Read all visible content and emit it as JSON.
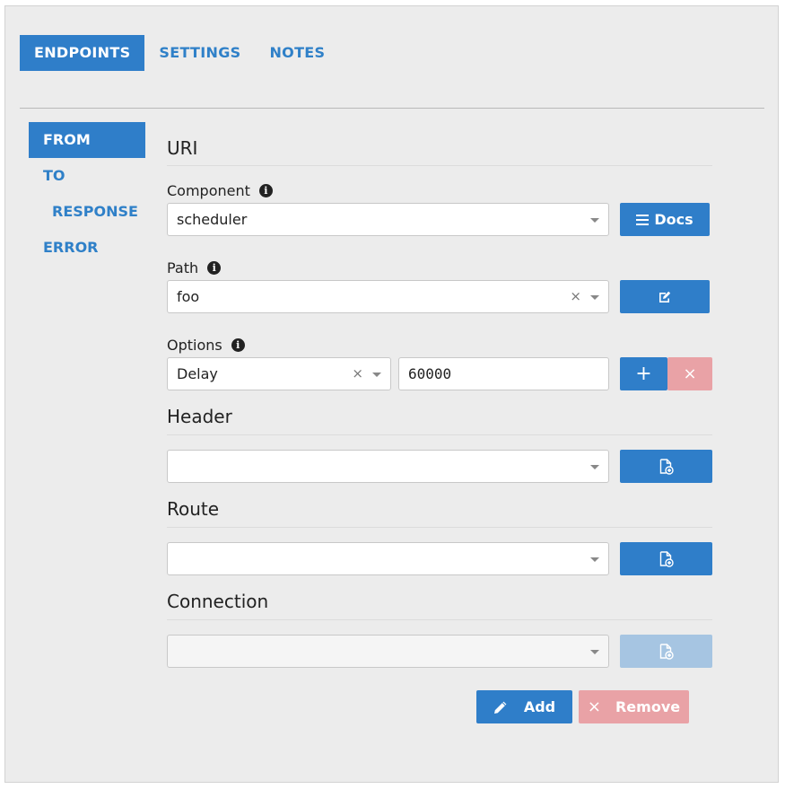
{
  "tabs": [
    {
      "label": "ENDPOINTS"
    },
    {
      "label": "SETTINGS"
    },
    {
      "label": "NOTES"
    }
  ],
  "sidebar": {
    "items": [
      {
        "label": "FROM"
      },
      {
        "label": "TO"
      },
      {
        "label": "RESPONSE"
      },
      {
        "label": "ERROR"
      }
    ]
  },
  "uri": {
    "title": "URI",
    "component": {
      "label": "Component",
      "value": "scheduler",
      "docs_label": "Docs"
    },
    "path": {
      "label": "Path",
      "value": "foo"
    },
    "options": {
      "label": "Options",
      "key": "Delay",
      "value": "60000"
    }
  },
  "header": {
    "title": "Header",
    "value": ""
  },
  "route": {
    "title": "Route",
    "value": ""
  },
  "connection": {
    "title": "Connection",
    "value": ""
  },
  "actions": {
    "add_label": "Add",
    "remove_label": "Remove"
  },
  "icons": {
    "info": "info-icon",
    "clear": "×",
    "docs": "list-icon",
    "edit": "edit-icon",
    "plus": "+",
    "remove": "×",
    "new_file": "file-plus-icon",
    "pencil": "pencil-icon"
  },
  "colors": {
    "primary": "#2f7ec9",
    "danger": "#e9a2a6",
    "disabled": "#a6c5e2"
  }
}
